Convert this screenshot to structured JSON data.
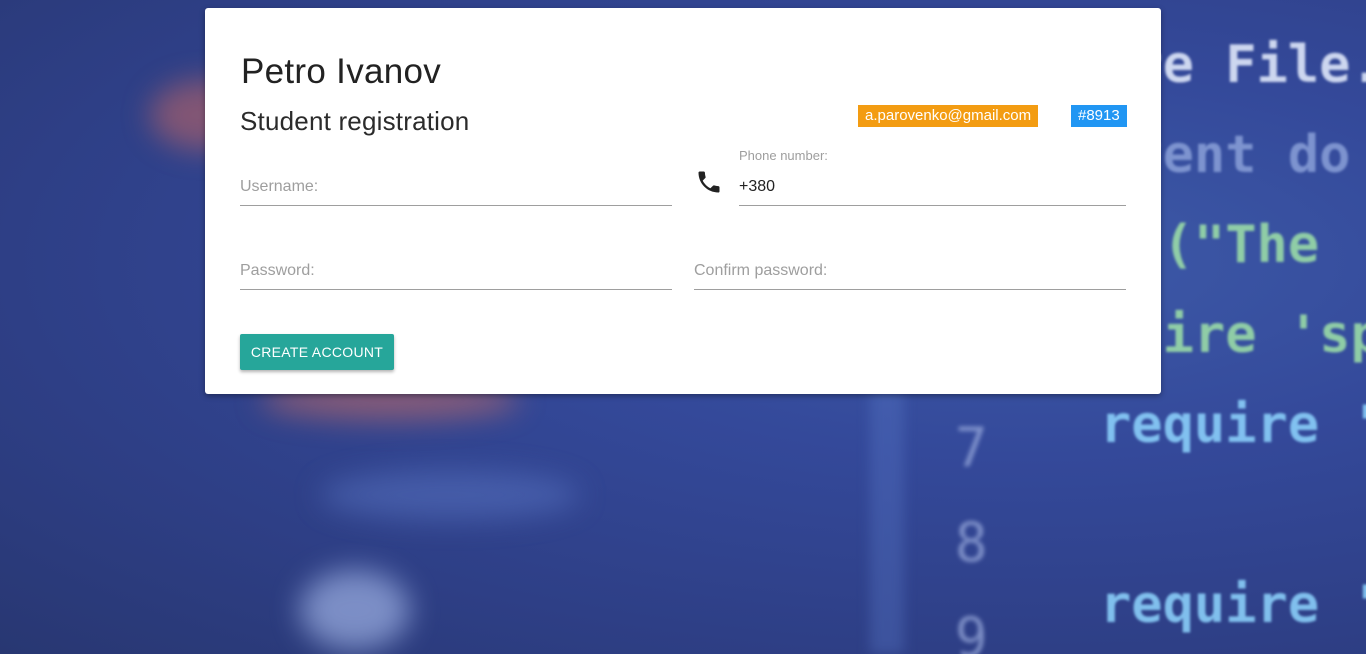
{
  "profile": {
    "name": "Petro Ivanov",
    "subtitle": "Student registration",
    "email_badge": "a.parovenko@gmail.com",
    "id_badge": "#8913"
  },
  "form": {
    "username_placeholder": "Username:",
    "phone_label": "Phone number:",
    "phone_value": "+380",
    "password_placeholder": "Password:",
    "confirm_password_placeholder": "Confirm password:",
    "submit_label": "CREATE ACCOUNT"
  },
  "icons": {
    "phone": "phone-icon"
  },
  "colors": {
    "email_badge": "#f39c12",
    "id_badge": "#2196f3",
    "button": "#26a69a"
  }
}
